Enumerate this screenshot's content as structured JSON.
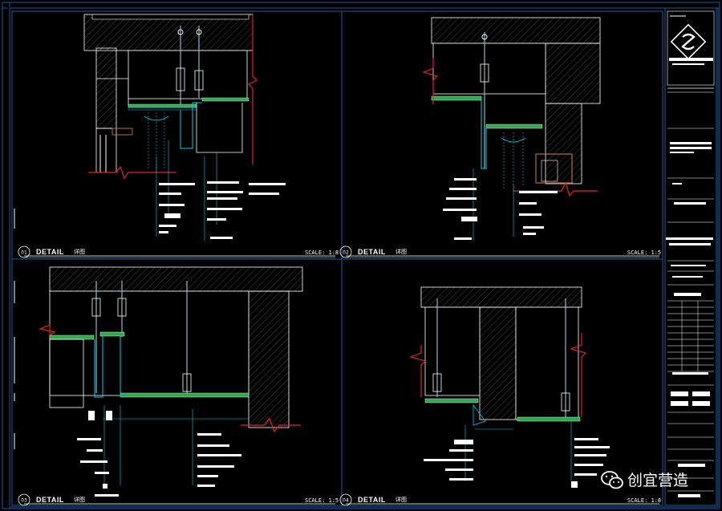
{
  "details": [
    {
      "num": "01",
      "title": "DETAIL",
      "sub": "详图",
      "scale": "SCALE: 1:8"
    },
    {
      "num": "02",
      "title": "DETAIL",
      "sub": "详图",
      "scale": "SCALE: 1:5"
    },
    {
      "num": "03",
      "title": "DETAIL",
      "sub": "详图",
      "scale": "SCALE: 1:5"
    },
    {
      "num": "04",
      "title": "DETAIL",
      "sub": "详图",
      "scale": "SCALE: 1:8"
    }
  ],
  "watermark": {
    "text": "创宜营造"
  },
  "colors": {
    "frame": "#1e5a9e",
    "cyan": "#00cfe8",
    "green": "#2fa84f",
    "red": "#e6202a",
    "white": "#ffffff",
    "hatch": "#8a8a8a"
  }
}
